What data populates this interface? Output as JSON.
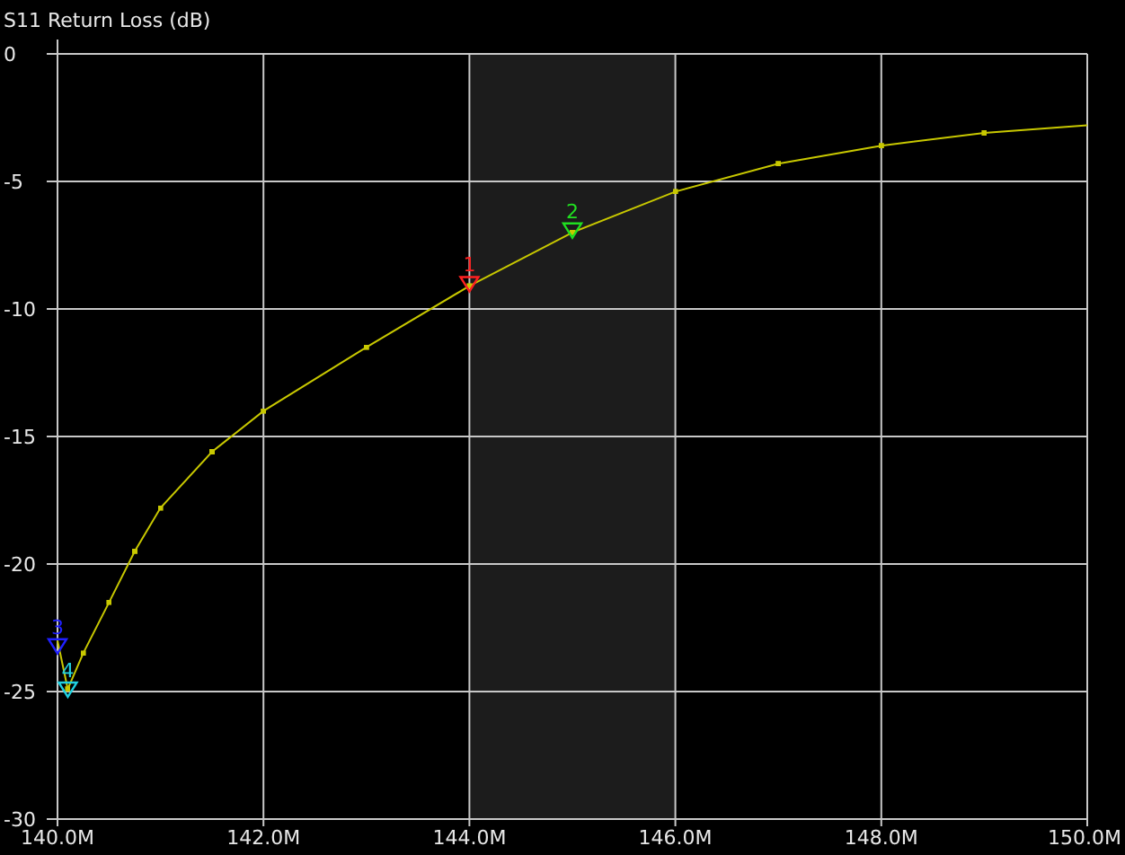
{
  "chart_data": {
    "type": "line",
    "title": "S11 Return Loss (dB)",
    "grid": true,
    "x": [
      140.0,
      140.1,
      140.25,
      140.5,
      140.75,
      141.0,
      141.5,
      142.0,
      143.0,
      144.0,
      145.0,
      146.0,
      147.0,
      148.0,
      149.0,
      150.0
    ],
    "series": [
      {
        "color": "#c8c800",
        "values": [
          -23.0,
          -24.9,
          -23.5,
          -21.5,
          -19.5,
          -17.8,
          -15.6,
          -14.0,
          -11.5,
          -9.1,
          -7.0,
          -5.4,
          -4.3,
          -3.6,
          -3.1,
          -2.8
        ]
      }
    ],
    "xlim": [
      140,
      150
    ],
    "ylim": [
      -30,
      0
    ],
    "xticks": [
      {
        "value": 140,
        "label": "140.0M"
      },
      {
        "value": 142,
        "label": "142.0M"
      },
      {
        "value": 144,
        "label": "144.0M"
      },
      {
        "value": 146,
        "label": "146.0M"
      },
      {
        "value": 148,
        "label": "148.0M"
      },
      {
        "value": 150,
        "label": "150.0M"
      }
    ],
    "yticks": [
      0,
      -5,
      -10,
      -15,
      -20,
      -25,
      -30
    ],
    "bands": [
      {
        "axis": "x",
        "from": 144,
        "to": 146,
        "color": "#1c1c1c"
      }
    ],
    "annotations": [
      {
        "text": "1",
        "x": 144.0,
        "y": -9.1
      },
      {
        "text": "2",
        "x": 145.0,
        "y": -7.0
      },
      {
        "text": "3",
        "x": 140.0,
        "y": -23.3
      },
      {
        "text": "4",
        "x": 140.1,
        "y": -25.0
      }
    ]
  },
  "markers": [
    {
      "color": "#ff2020"
    },
    {
      "color": "#20e020"
    },
    {
      "color": "#2020ff"
    },
    {
      "color": "#20d0e0"
    }
  ]
}
